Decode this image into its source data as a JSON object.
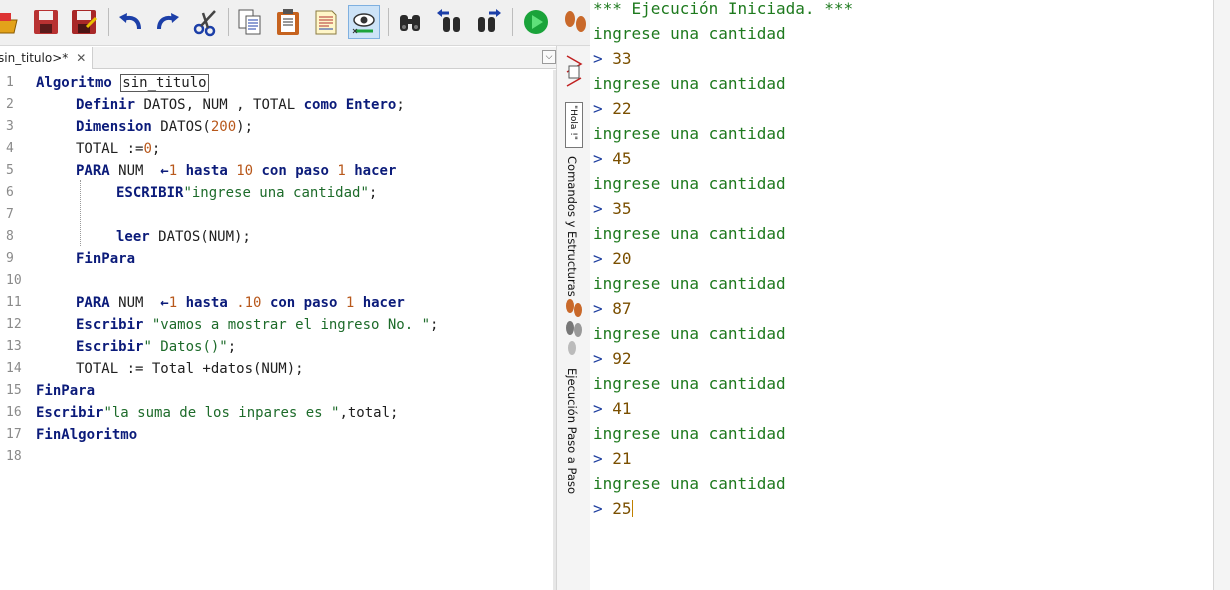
{
  "editor": {
    "tab_label": "sin_titulo>*",
    "tab_close": "✕",
    "dropdown_arrow": "⌵",
    "line_numbers": [
      "1",
      "2",
      "3",
      "4",
      "5",
      "6",
      "7",
      "8",
      "9",
      "10",
      "11",
      "12",
      "13",
      "14",
      "15",
      "16",
      "17",
      "18"
    ],
    "lines": {
      "l1_kw": "Algoritmo",
      "l1_name": "sin_titulo",
      "l2_kw1": "Definir",
      "l2_vars": " DATOS, NUM , TOTAL ",
      "l2_kw2": "como",
      "l2_kw3": "Entero",
      "l2_end": ";",
      "l3_kw": "Dimension",
      "l3_a": " DATOS(",
      "l3_num": "200",
      "l3_b": ");",
      "l4_a": "TOTAL :=",
      "l4_num": "0",
      "l4_b": ";",
      "l5_kw1": "PARA",
      "l5_a": " NUM  ",
      "l5_arrow": "←",
      "l5_n1": "1",
      "l5_kw2": "hasta",
      "l5_n2": "10",
      "l5_kw3": "con paso",
      "l5_n3": "1",
      "l5_kw4": "hacer",
      "l6_kw": "ESCRIBIR",
      "l6_str": "\"ingrese una cantidad\"",
      "l6_end": ";",
      "l8_kw": "leer",
      "l8_a": " DATOS(NUM);",
      "l9_kw": "FinPara",
      "l11_kw1": "PARA",
      "l11_a": " NUM  ",
      "l11_arrow": "←",
      "l11_n1": "1",
      "l11_kw2": "hasta",
      "l11_n2": ".10",
      "l11_kw3": "con paso",
      "l11_n3": "1",
      "l11_kw4": "hacer",
      "l12_kw": "Escribir",
      "l12_str": "\"vamos a mostrar el ingreso No. \"",
      "l12_end": ";",
      "l13_kw": "Escribir",
      "l13_str": "\" Datos()\"",
      "l13_end": ";",
      "l14_a": "TOTAL := Total +datos(NUM);",
      "l15_kw": "FinPara",
      "l16_kw": "Escribir",
      "l16_str": "\"la suma de los inpares es \"",
      "l16_end": ",total;",
      "l17_kw": "FinAlgoritmo"
    }
  },
  "sidebar": {
    "panel1_label": "Comandos y Estructuras",
    "panel2_label": "Ejecución Paso a Paso",
    "hola_label": "\"Hola !\""
  },
  "console": {
    "header": "*** Ejecución Iniciada. ***",
    "prompt_text": "ingrese una cantidad",
    "prompt_symbol": ">",
    "inputs": [
      "33",
      "22",
      "45",
      "35",
      "20",
      "87",
      "92",
      "41",
      "21",
      "25"
    ]
  },
  "toolbar": {
    "icons": [
      "folder-open-icon",
      "save-icon",
      "save-as-icon",
      "undo-icon",
      "redo-icon",
      "cut-icon",
      "copy-icon",
      "paste-icon",
      "copy-document-icon",
      "inspect-icon",
      "search-icon",
      "search-previous-icon",
      "search-next-icon",
      "run-icon",
      "step-run-icon"
    ]
  },
  "colors": {
    "keyword": "#0b1b7a",
    "string": "#1d6b2a",
    "number": "#b8581b",
    "console_text": "#1e7a1e",
    "run_green": "#1aa33a"
  }
}
